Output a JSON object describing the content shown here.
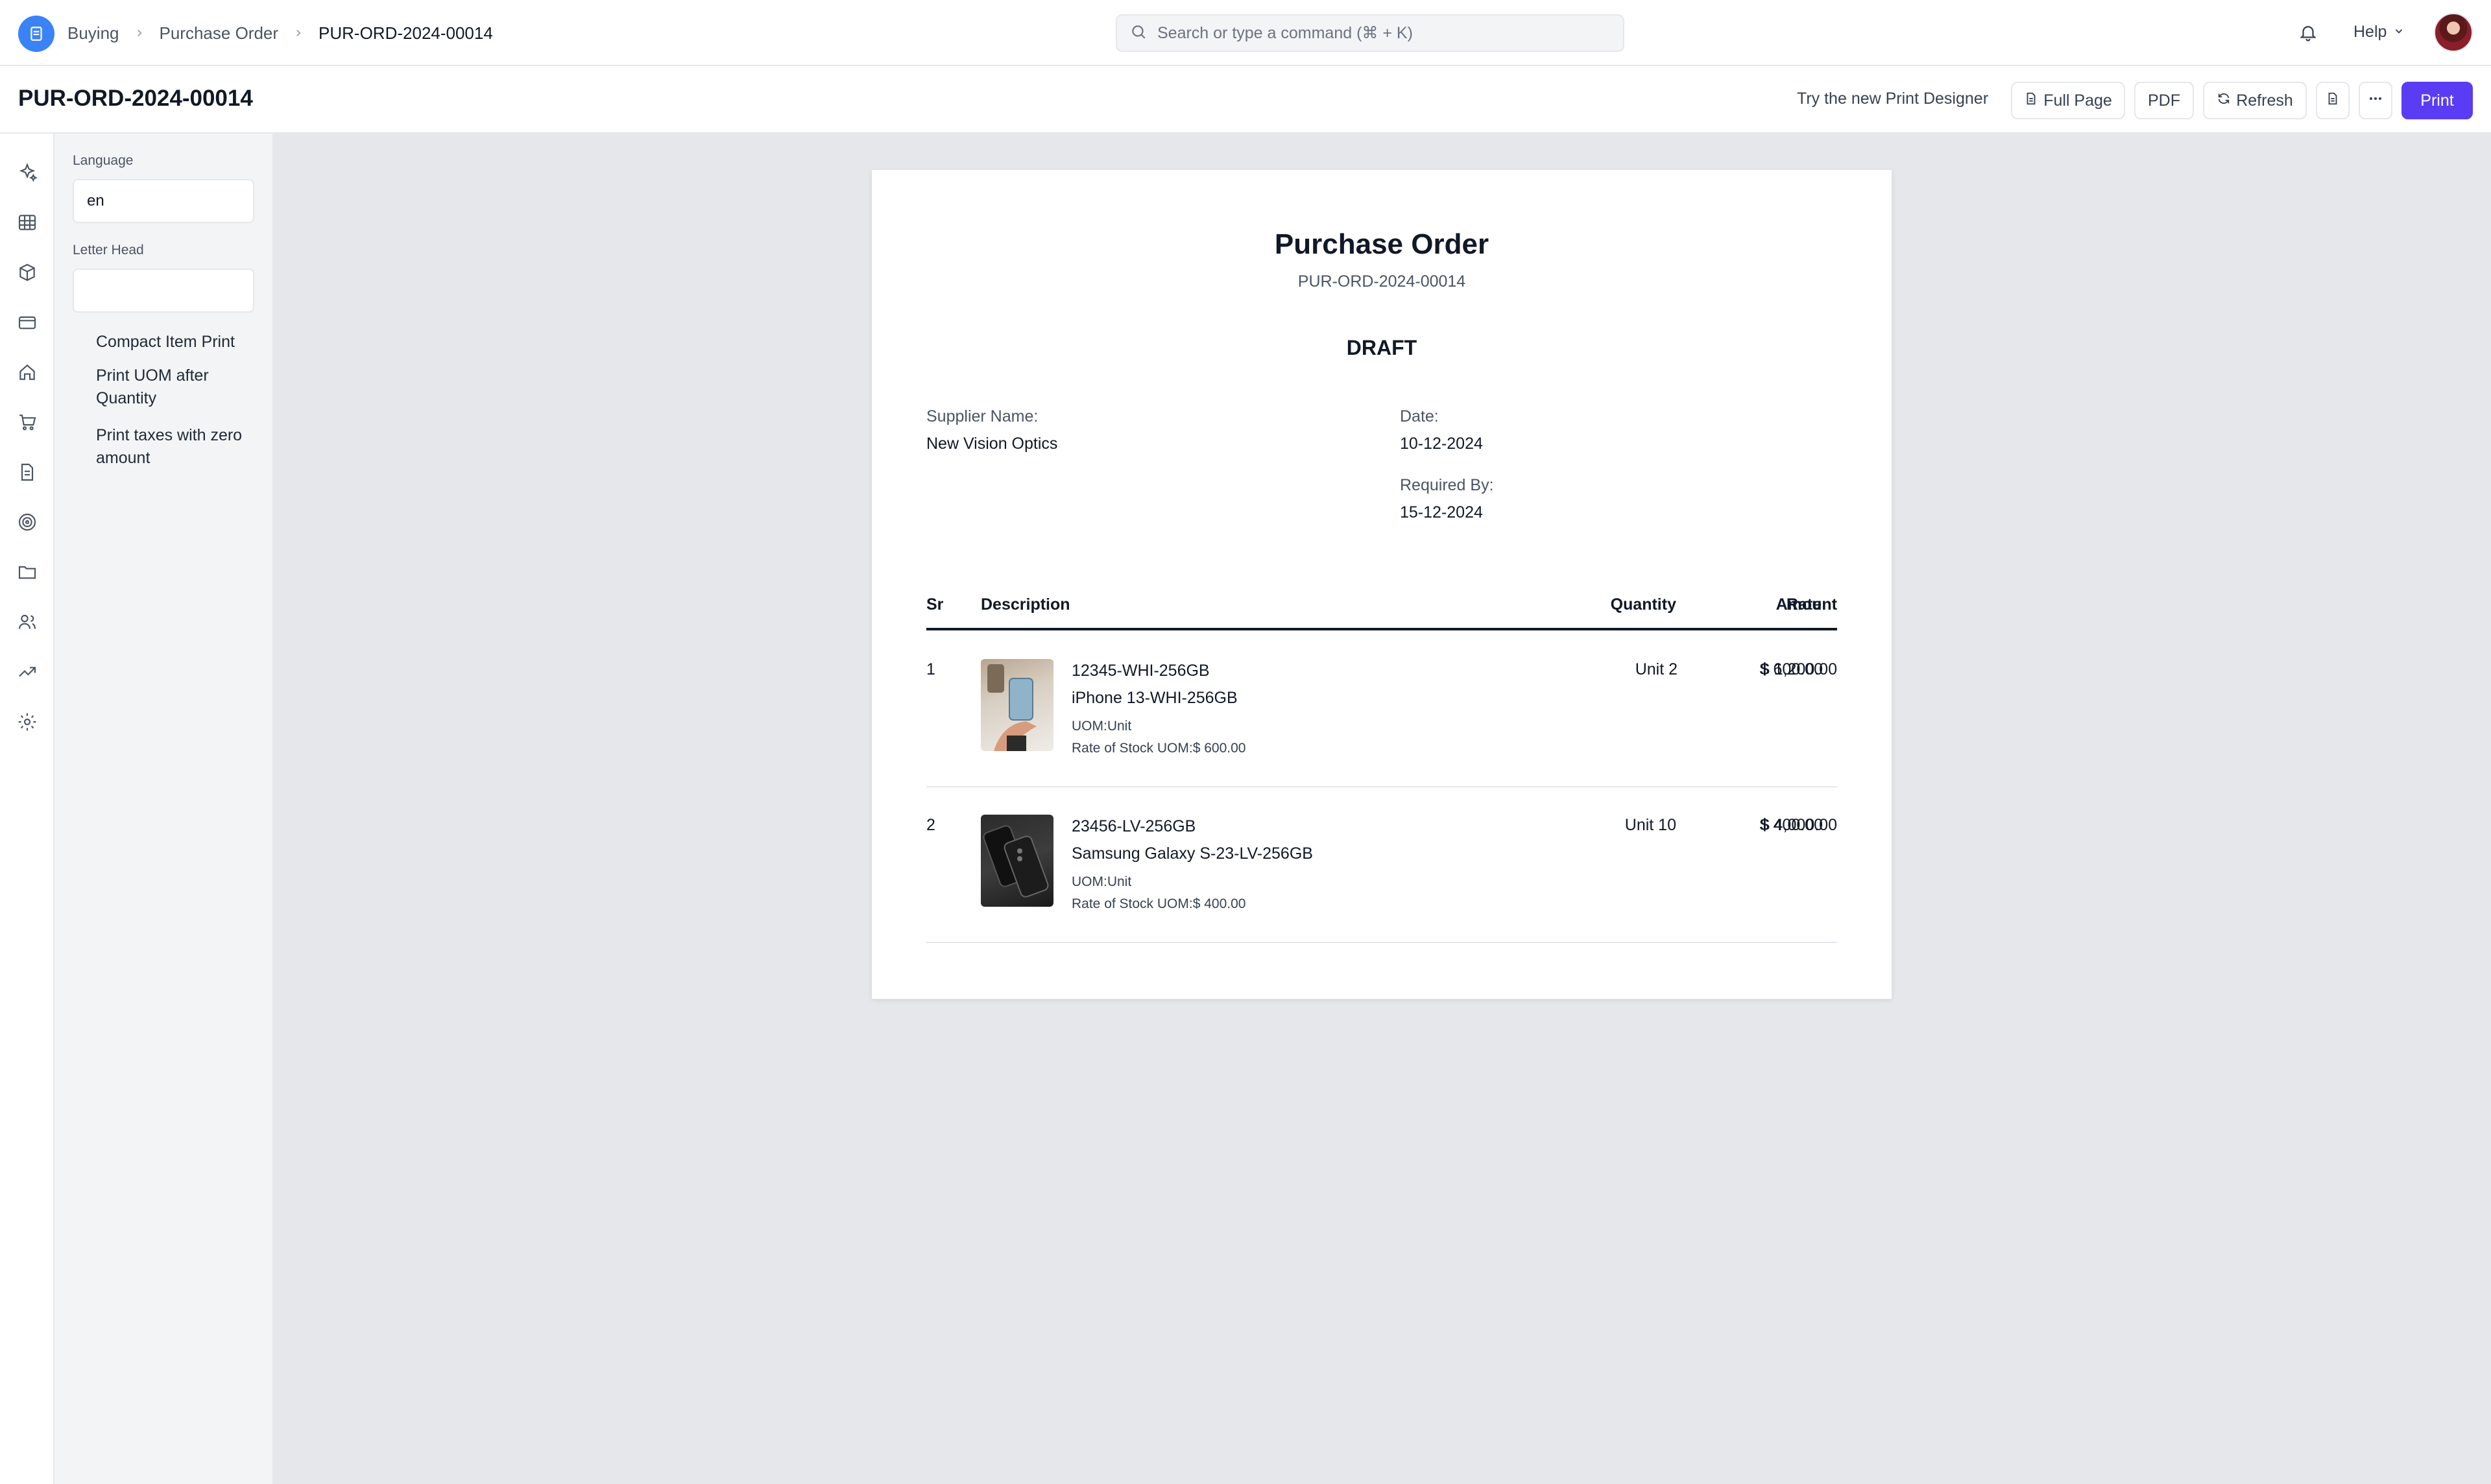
{
  "navbar": {
    "breadcrumbs": [
      "Buying",
      "Purchase Order",
      "PUR-ORD-2024-00014"
    ],
    "search_placeholder": "Search or type a command (⌘ + K)",
    "help_label": "Help"
  },
  "header": {
    "title": "PUR-ORD-2024-00014",
    "try_designer": "Try the new Print Designer",
    "full_page": "Full Page",
    "pdf": "PDF",
    "refresh": "Refresh",
    "print": "Print"
  },
  "rail_icons": [
    "sparkle-icon",
    "table-icon",
    "box-icon",
    "card-icon",
    "home-icon",
    "cart-icon",
    "document-icon",
    "target-icon",
    "folder-icon",
    "users-icon",
    "trend-icon",
    "settings-icon"
  ],
  "options": {
    "language_label": "Language",
    "language_value": "en",
    "letter_head_label": "Letter Head",
    "letter_head_value": "",
    "checks": [
      "Compact Item Print",
      "Print UOM after Quantity",
      "Print taxes with zero amount"
    ]
  },
  "document": {
    "title": "Purchase Order",
    "number": "PUR-ORD-2024-00014",
    "status": "DRAFT",
    "supplier_label": "Supplier Name:",
    "supplier_value": "New Vision Optics",
    "date_label": "Date:",
    "date_value": "10-12-2024",
    "required_label": "Required By:",
    "required_value": "15-12-2024",
    "columns": [
      "Sr",
      "Description",
      "Quantity",
      "Rate",
      "Amount"
    ],
    "rows": [
      {
        "sr": "1",
        "code": "12345-WHI-256GB",
        "name": "iPhone 13-WHI-256GB",
        "uom": "UOM:Unit",
        "stock_rate": "Rate of Stock UOM:$ 600.00",
        "qty": "Unit 2",
        "rate": "$ 600.00",
        "amount": "$ 1,200.00"
      },
      {
        "sr": "2",
        "code": "23456-LV-256GB",
        "name": "Samsung Galaxy S-23-LV-256GB",
        "uom": "UOM:Unit",
        "stock_rate": "Rate of Stock UOM:$ 400.00",
        "qty": "Unit 10",
        "rate": "$ 400.00",
        "amount": "$ 4,000.00"
      }
    ]
  },
  "colors": {
    "primary": "#5b3cf5",
    "logo": "#3b82f6",
    "background": "#e5e7eb"
  }
}
